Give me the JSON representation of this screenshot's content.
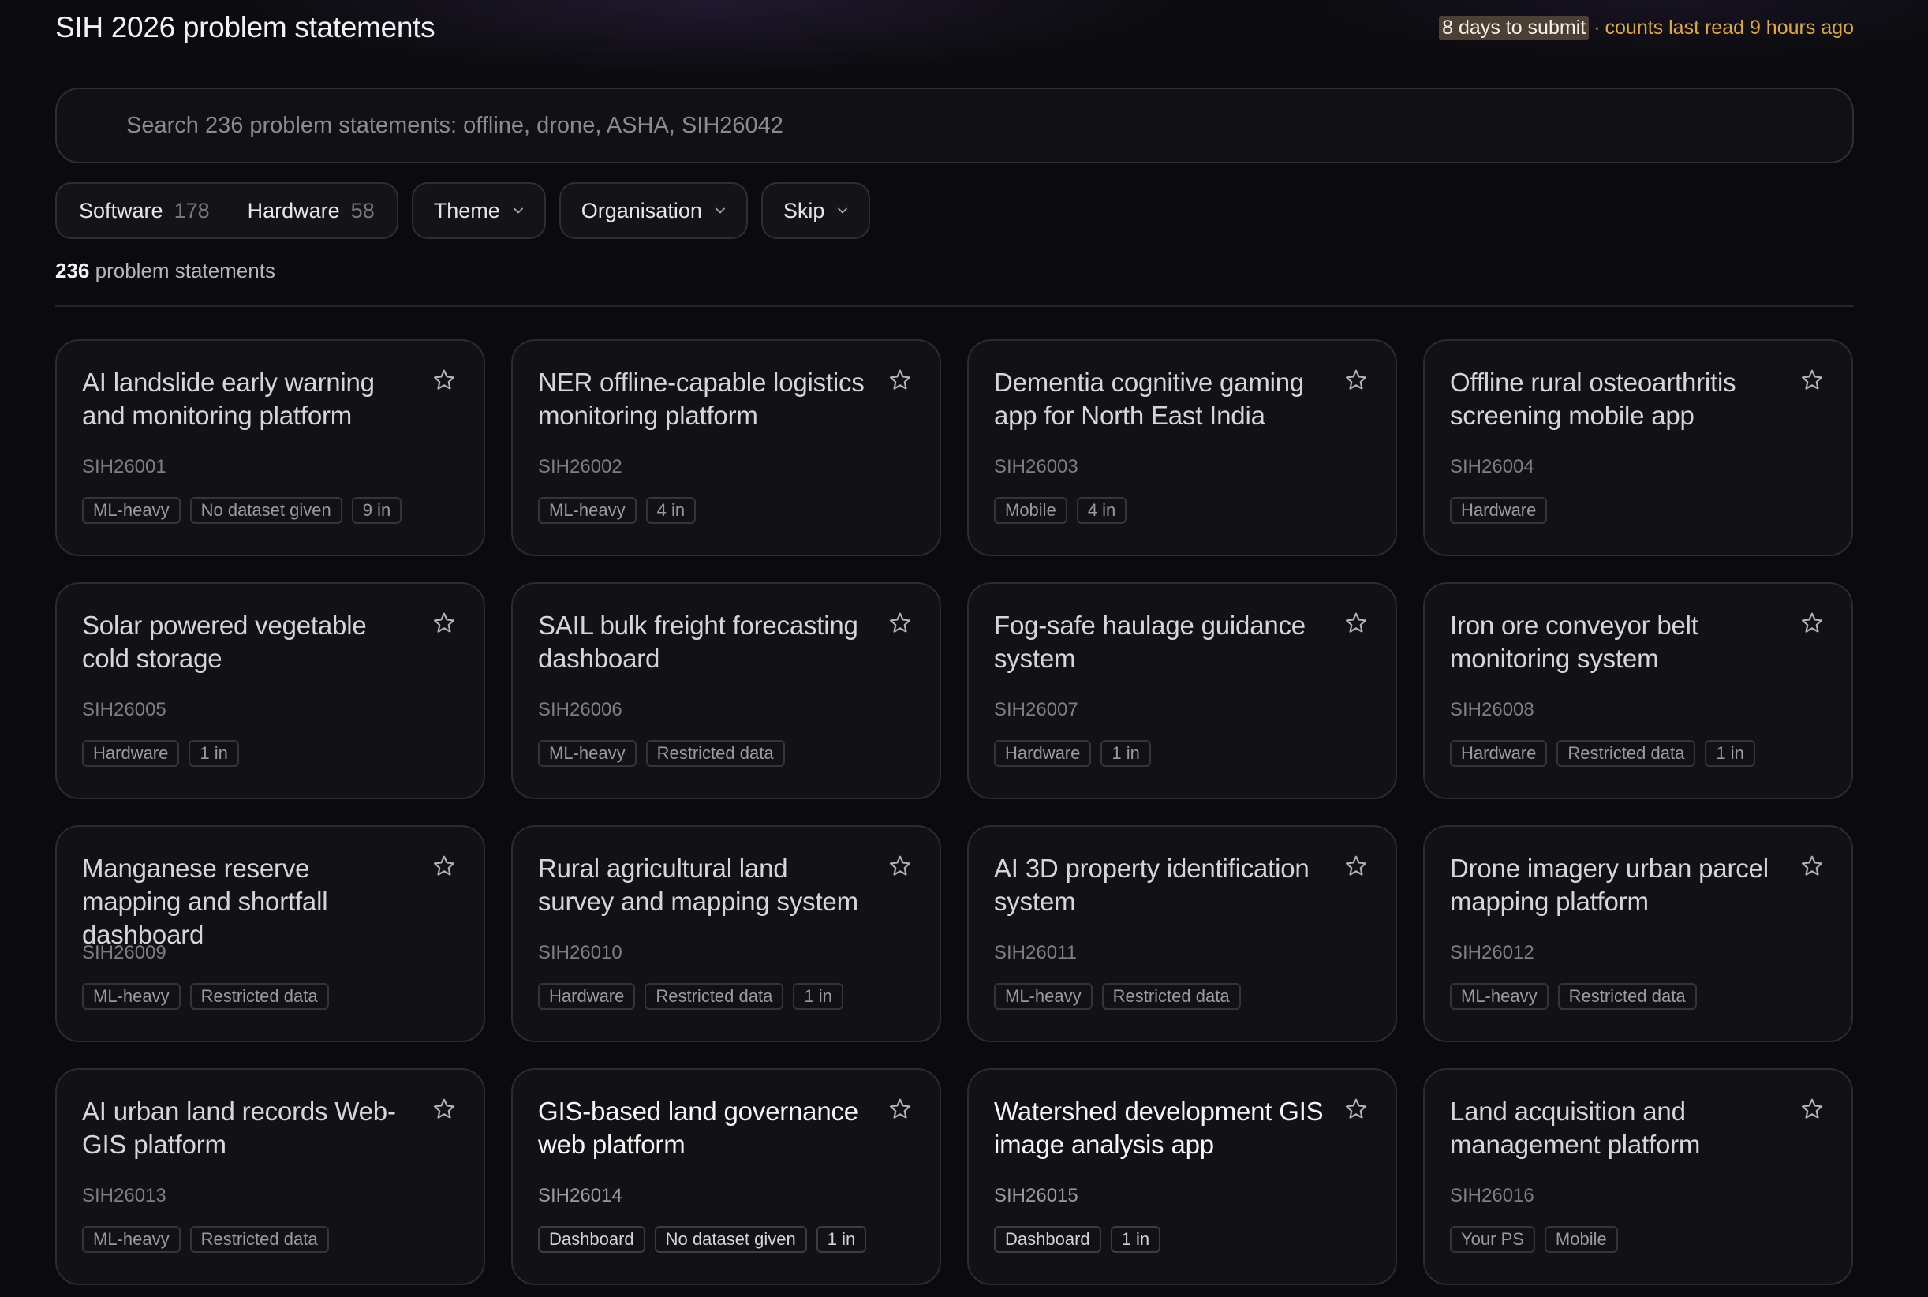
{
  "header": {
    "title": "SIH 2026 problem statements",
    "deadline": "8 days to submit",
    "separator": "·",
    "counts_note": "counts last read 9 hours ago"
  },
  "search": {
    "placeholder": "Search 236 problem statements: offline, drone, ASHA, SIH26042"
  },
  "filters": {
    "software_label": "Software",
    "software_count": "178",
    "hardware_label": "Hardware",
    "hardware_count": "58",
    "theme_label": "Theme",
    "organisation_label": "Organisation",
    "skip_label": "Skip"
  },
  "results": {
    "count": "236",
    "label": "problem statements"
  },
  "cards": [
    {
      "title": "AI landslide early warning and monitoring platform",
      "code": "SIH26001",
      "tags": [
        "ML-heavy",
        "No dataset given",
        "9 in"
      ]
    },
    {
      "title": "NER offline-capable logistics monitoring platform",
      "code": "SIH26002",
      "tags": [
        "ML-heavy",
        "4 in"
      ]
    },
    {
      "title": "Dementia cognitive gaming app for North East India",
      "code": "SIH26003",
      "tags": [
        "Mobile",
        "4 in"
      ]
    },
    {
      "title": "Offline rural osteoarthritis screening mobile app",
      "code": "SIH26004",
      "tags": [
        "Hardware"
      ]
    },
    {
      "title": "Solar powered vegetable cold storage",
      "code": "SIH26005",
      "tags": [
        "Hardware",
        "1 in"
      ]
    },
    {
      "title": "SAIL bulk freight forecasting dashboard",
      "code": "SIH26006",
      "tags": [
        "ML-heavy",
        "Restricted data"
      ]
    },
    {
      "title": "Fog-safe haulage guidance system",
      "code": "SIH26007",
      "tags": [
        "Hardware",
        "1 in"
      ]
    },
    {
      "title": "Iron ore conveyor belt monitoring system",
      "code": "SIH26008",
      "tags": [
        "Hardware",
        "Restricted data",
        "1 in"
      ]
    },
    {
      "title": "Manganese reserve mapping and shortfall dashboard",
      "code": "SIH26009",
      "tags": [
        "ML-heavy",
        "Restricted data"
      ]
    },
    {
      "title": "Rural agricultural land survey and mapping system",
      "code": "SIH26010",
      "tags": [
        "Hardware",
        "Restricted data",
        "1 in"
      ]
    },
    {
      "title": "AI 3D property identification system",
      "code": "SIH26011",
      "tags": [
        "ML-heavy",
        "Restricted data"
      ]
    },
    {
      "title": "Drone imagery urban parcel mapping platform",
      "code": "SIH26012",
      "tags": [
        "ML-heavy",
        "Restricted data"
      ]
    },
    {
      "title": "AI urban land records Web-GIS platform",
      "code": "SIH26013",
      "tags": [
        "ML-heavy",
        "Restricted data"
      ]
    },
    {
      "title": "GIS-based land governance web platform",
      "code": "SIH26014",
      "tags": [
        "Dashboard",
        "No dataset given",
        "1 in"
      ]
    },
    {
      "title": "Watershed development GIS image analysis app",
      "code": "SIH26015",
      "tags": [
        "Dashboard",
        "1 in"
      ]
    },
    {
      "title": "Land acquisition and management platform",
      "code": "SIH26016",
      "tags": [
        "Your PS",
        "Mobile"
      ]
    }
  ],
  "colors": {
    "accent_deadline": "#e0a93b",
    "background": "#0b0b0d",
    "card": "#121215"
  },
  "icons": {
    "favorite": "star-icon",
    "dropdown": "chevron-down-icon"
  }
}
